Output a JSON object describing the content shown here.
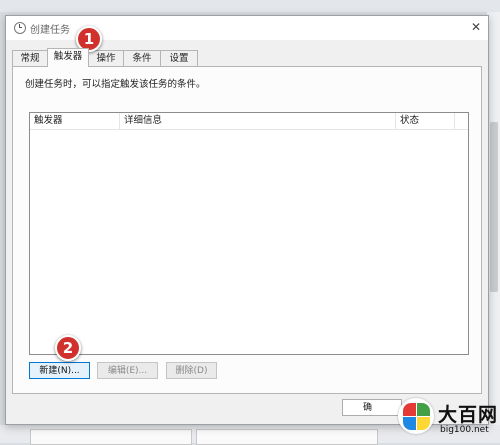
{
  "dialog": {
    "title": "创建任务",
    "close_glyph": "✕",
    "tabs": [
      {
        "label": "常规"
      },
      {
        "label": "触发器",
        "active": true
      },
      {
        "label": "操作"
      },
      {
        "label": "条件"
      },
      {
        "label": "设置"
      }
    ],
    "description": "创建任务时，可以指定触发该任务的条件。",
    "table": {
      "columns": [
        "触发器",
        "详细信息",
        "状态"
      ],
      "rows": []
    },
    "buttons": {
      "new": "新建(N)...",
      "edit": "编辑(E)...",
      "delete": "删除(D)"
    },
    "ok_partial": "确"
  },
  "annotations": {
    "marker_1": "1",
    "marker_2": "2"
  },
  "watermark": {
    "title": "大百网",
    "url": "big100.net",
    "colors": [
      "#e53935",
      "#43a047",
      "#1e88e5",
      "#fdd835"
    ]
  },
  "colors": {
    "marker": "#d0312d",
    "focus_border": "#0078d7"
  }
}
